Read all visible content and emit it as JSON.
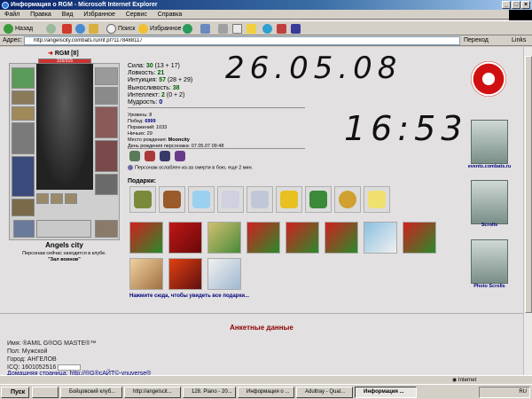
{
  "window": {
    "title": "Информация о RGM - Microsoft Internet Explorer"
  },
  "menu": [
    "Файл",
    "Правка",
    "Вид",
    "Избранное",
    "Сервис",
    "Справка"
  ],
  "toolbar": {
    "back_label": "Назад",
    "search_label": "Поиск",
    "favorites_label": "Избранное"
  },
  "address": {
    "label": "Адрес:",
    "url": "http://angelscity.combats.ru/inf.pl?1178488117",
    "go_label": "Переход",
    "links_label": "Links"
  },
  "character": {
    "header_name": "RGM [8]",
    "hp_text": "315/315",
    "hp_fraction": 1.0,
    "clan": "Angels city",
    "location": "Персонаж сейчас находится в клубе.",
    "room": "\"Зал воинов\""
  },
  "stats": [
    {
      "label": "Сила:",
      "value": "30",
      "extra": "(13 + 17)"
    },
    {
      "label": "Ловкость:",
      "value": "21",
      "extra": ""
    },
    {
      "label": "Интуиция:",
      "value": "57",
      "extra": "(28 + 29)"
    },
    {
      "label": "Выносливость:",
      "value": "38",
      "extra": ""
    },
    {
      "label": "Интеллект:",
      "value": "2",
      "extra": "(0 + 2)"
    },
    {
      "label": "Мудрость:",
      "value": "0",
      "extra": ""
    }
  ],
  "info": {
    "level": "Уровень: 8",
    "wins_label": "Побед:",
    "wins": "6999",
    "losses": "Поражений: 1033",
    "draws": "Ничьих: 29",
    "birthplace_label": "Место рождения:",
    "birthplace": "Mooncity",
    "birthday": "День рождения персонажа: 07.05.07 09:48"
  },
  "debuff": "Персонаж ослаблен из-за смерти в бою, еще 2 мин.",
  "handwriting": {
    "date": "26.05.08",
    "time": "16:53"
  },
  "gifts": {
    "label": "Подарки:",
    "more_link": "Нажмите сюда, чтобы увидеть все подарки..."
  },
  "right_panel": {
    "events": "events.combats.ru",
    "scrolls": "Scrolls",
    "photo_scrolls": "Photo Scrolls"
  },
  "profile": {
    "heading": "Анкетные данные",
    "name": "Имя: ®AMIL G®OG MASTE®™",
    "gender": "Пол: Мужской",
    "city": "Город: АНГЕЛОВ",
    "icq": "ICQ: 1601052516",
    "homepage": "Домашняя страница: http://®G®cAЙT©-ynuverse®"
  },
  "status": {
    "left": "",
    "zone": "Internet"
  },
  "taskbar": {
    "start": "Пуск",
    "tasks": [
      "Бойцовский клуб...",
      "http://angelscit...",
      "128. Piano - 20...",
      "Информация о ...",
      "Adultray - Qual...",
      "Информация ..."
    ],
    "tray": "RU"
  },
  "colors": {
    "titlebar": "#0a246a",
    "accent_red": "#d01010",
    "link": "#00007f"
  }
}
